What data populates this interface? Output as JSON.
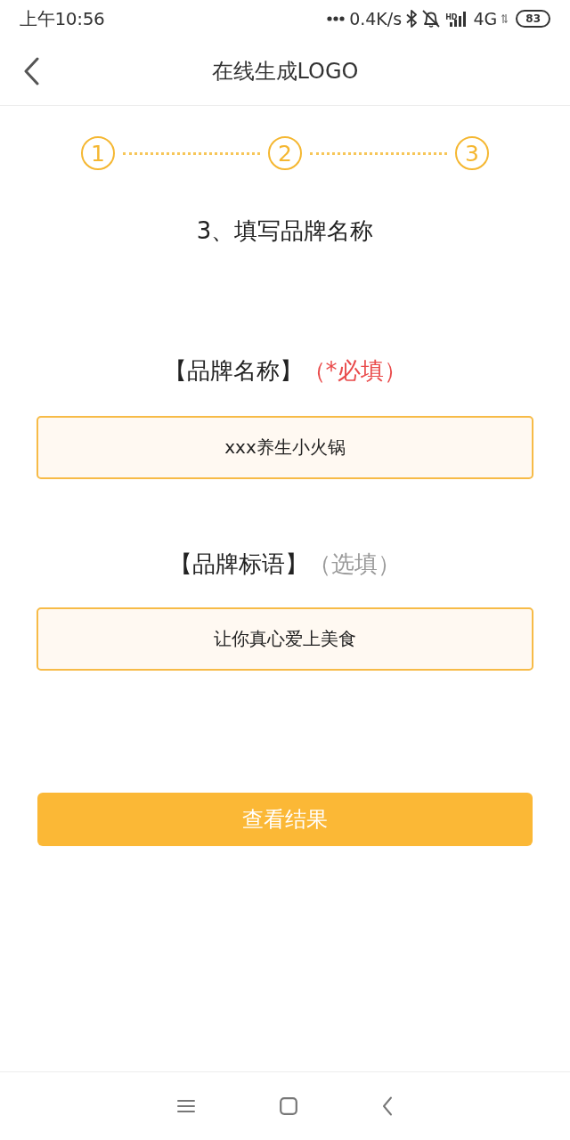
{
  "status_bar": {
    "time": "上午10:56",
    "network_speed": "0.4K/s",
    "hd_label": "HD",
    "network_type": "4G",
    "battery": "83"
  },
  "header": {
    "title": "在线生成LOGO"
  },
  "steps": [
    {
      "label": "1"
    },
    {
      "label": "2"
    },
    {
      "label": "3"
    }
  ],
  "step_title": "3、填写品牌名称",
  "fields": [
    {
      "label": "【品牌名称】",
      "note": "（*必填）",
      "required": true,
      "value": "xxx养生小火锅"
    },
    {
      "label": "【品牌标语】",
      "note": "（选填）",
      "required": false,
      "value": "让你真心爱上美食"
    }
  ],
  "submit_button": "查看结果"
}
